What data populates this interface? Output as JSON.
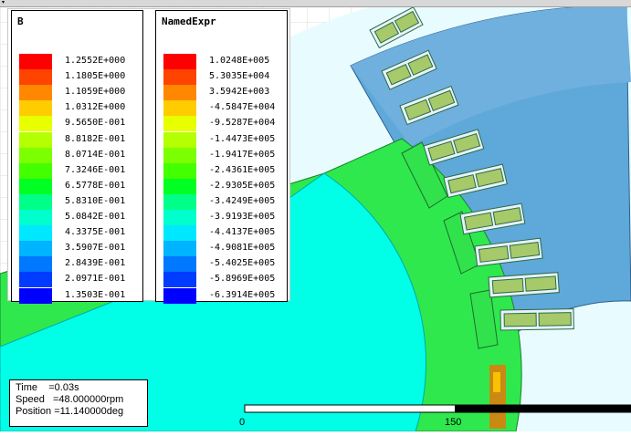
{
  "legend_b": {
    "title": "B",
    "labels": [
      "1.2552E+000",
      "1.1805E+000",
      "1.1059E+000",
      "1.0312E+000",
      "9.5650E-001",
      "8.8182E-001",
      "8.0714E-001",
      "7.3246E-001",
      "6.5778E-001",
      "5.8310E-001",
      "5.0842E-001",
      "4.3375E-001",
      "3.5907E-001",
      "2.8439E-001",
      "2.0971E-001",
      "1.3503E-001"
    ]
  },
  "legend_expr": {
    "title": "NamedExpr",
    "labels": [
      "1.0248E+005",
      "5.3035E+004",
      "3.5942E+003",
      "-4.5847E+004",
      "-9.5287E+004",
      "-1.4473E+005",
      "-1.9417E+005",
      "-2.4361E+005",
      "-2.9305E+005",
      "-3.4249E+005",
      "-3.9193E+005",
      "-4.4137E+005",
      "-4.9081E+005",
      "-5.4025E+005",
      "-5.8969E+005",
      "-6.3914E+005"
    ]
  },
  "colors": [
    "#ff0000",
    "#ff4400",
    "#ff8800",
    "#ffcc00",
    "#e8ff00",
    "#b4ff00",
    "#7cff00",
    "#44ff00",
    "#00ff22",
    "#00ff88",
    "#00ffcc",
    "#00e8ff",
    "#00b4ff",
    "#0078ff",
    "#003cff",
    "#0000ff"
  ],
  "info": {
    "time": "Time    =0.03s",
    "speed": "Speed   =48.000000rpm",
    "position": "Position =11.140000deg"
  },
  "scale": {
    "start": "0",
    "mid": "150"
  },
  "palette": {
    "grid": "#d9d9d9",
    "rotor_core": "#00ffe0",
    "rotor_ring": "#2fe84e",
    "stator": "#5aa8d8",
    "coil": "#9fcf6a"
  }
}
